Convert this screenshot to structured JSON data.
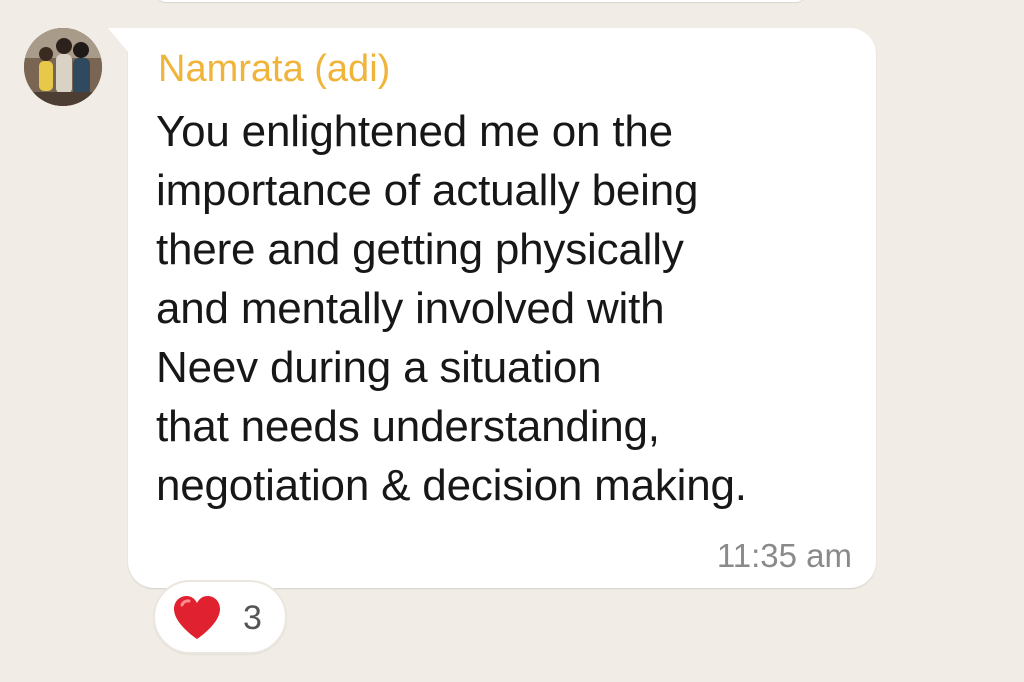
{
  "message": {
    "sender_name": "Namrata (adi)",
    "lines": [
      "You enlightened me on the",
      "importance of actually being",
      "there and getting physically",
      "and mentally involved with",
      "Neev during a situation",
      "that needs understanding,",
      "negotiation & decision making."
    ],
    "time": "11:35 am"
  },
  "reaction": {
    "icon": "heart-icon",
    "count": "3"
  },
  "colors": {
    "chat_background": "#f1ede6",
    "bubble": "#ffffff",
    "sender_name": "#f0b43a",
    "message_text": "#171717",
    "timestamp": "#8a8a8a",
    "heart": "#e0212f"
  }
}
